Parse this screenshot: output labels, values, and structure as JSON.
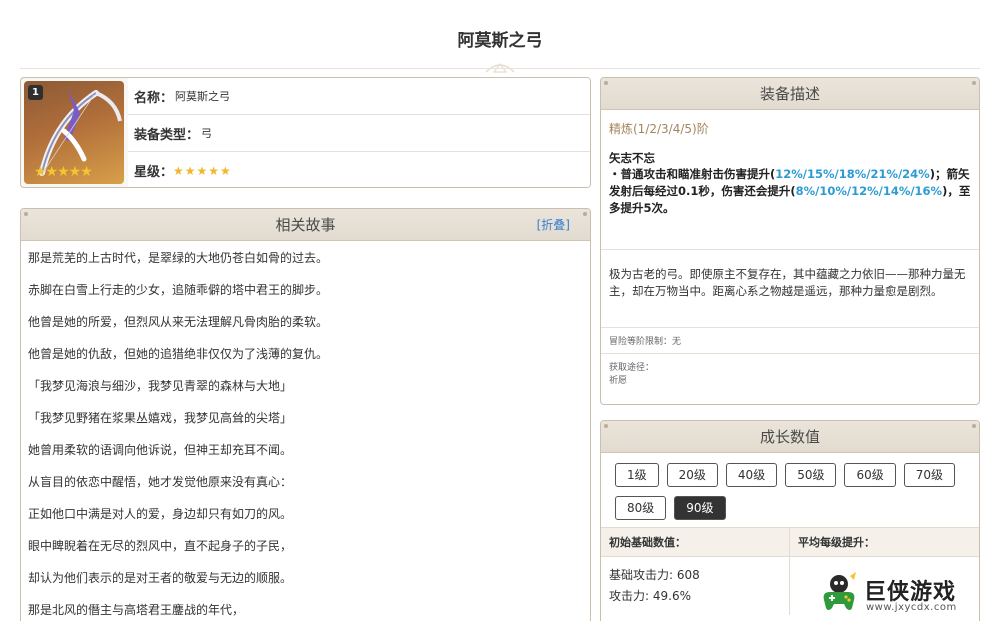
{
  "page": {
    "title": "阿莫斯之弓"
  },
  "info": {
    "name_label": "名称：",
    "name_value": "阿莫斯之弓",
    "type_label": "装备类型：",
    "type_value": "弓",
    "rarity_label": "星级：",
    "rarity_stars": "★★★★★",
    "refine_badge": "1",
    "pic_stars": "★★★★★"
  },
  "story": {
    "title": "相关故事",
    "fold_label": "[折叠]",
    "lines": [
      "那是荒芜的上古时代，是翠绿的大地仍苍白如骨的过去。",
      "赤脚在白雪上行走的少女，追随乖僻的塔中君王的脚步。",
      "他曾是她的所爱，但烈风从来无法理解凡骨肉胎的柔软。",
      "他曾是她的仇敌，但她的追猎绝非仅仅为了浅薄的复仇。",
      "「我梦见海浪与细沙，我梦见青翠的森林与大地」",
      "「我梦见野猪在浆果丛嬉戏，我梦见高耸的尖塔」",
      "她曾用柔软的语调向他诉说，但神王却充耳不闻。",
      "从盲目的依恋中醒悟，她才发觉他原来没有真心：",
      "正如他口中满是对人的爱，身边却只有如刀的风。",
      "眼中睥睨着在无尽的烈风中，直不起身子的子民，",
      "却认为他们表示的是对王者的敬爱与无边的顺服。",
      "那是北风的僭主与高塔君王鏖战的年代，"
    ]
  },
  "desc": {
    "title": "装备描述",
    "refine_label": "精炼(1/2/3/4/5)阶",
    "effect_name": "矢志不忘",
    "effect_p1": "・普通攻击和瞄准射击伤害提升(",
    "effect_h1": "12%/15%/18%/21%/24%",
    "effect_p2": ")；箭矢发射后每经过0.1秒，伤害还会提升(",
    "effect_h2": "8%/10%/12%/14%/16%",
    "effect_p3": ")，至多提升5次。",
    "lore": "极为古老的弓。即使原主不复存在，其中蕴藏之力依旧——那种力量无主，却在万物当中。距离心系之物越是遥远，那种力量愈是剧烈。",
    "level_limit": "冒险等阶限制：无",
    "source_label": "获取途径：",
    "source_value": "祈愿"
  },
  "growth": {
    "title": "成长数值",
    "levels": [
      "1级",
      "20级",
      "40级",
      "50级",
      "60级",
      "70级",
      "80级",
      "90级"
    ],
    "active_level": "90级",
    "col1_header": "初始基础数值：",
    "col2_header": "平均每级提升：",
    "base_atk": "基础攻击力: 608",
    "sub_stat": "攻击力: 49.6%"
  },
  "watermark": {
    "name": "巨侠游戏",
    "url": "www.jxycdx.com"
  },
  "colors": {
    "accent_blue": "#2d9bd3",
    "link_blue": "#3a7fd0",
    "refine_brown": "#a3865f",
    "header_bg": "#e6dfd4"
  }
}
